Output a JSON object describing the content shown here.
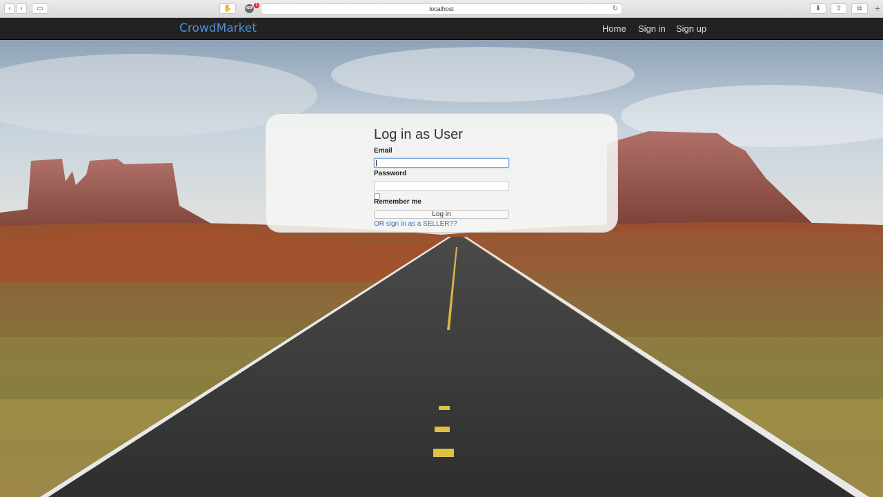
{
  "browser": {
    "url": "localhost",
    "back_icon": "chevron-left-icon",
    "forward_icon": "chevron-right-icon",
    "extension_badge_count": "1"
  },
  "navbar": {
    "brand": "CrowdMarket",
    "links": [
      {
        "label": "Home"
      },
      {
        "label": "Sign in"
      },
      {
        "label": "Sign up"
      }
    ]
  },
  "login": {
    "title": "Log in as User",
    "email_label": "Email",
    "email_value": "",
    "password_label": "Password",
    "password_value": "",
    "remember_label": "Remember me",
    "remember_checked": false,
    "submit_label": "Log in",
    "seller_link": "OR sign in as a SELLER??"
  },
  "colors": {
    "navbar_bg": "#222222",
    "brand": "#4d8fd0",
    "link": "#3a73b8"
  }
}
